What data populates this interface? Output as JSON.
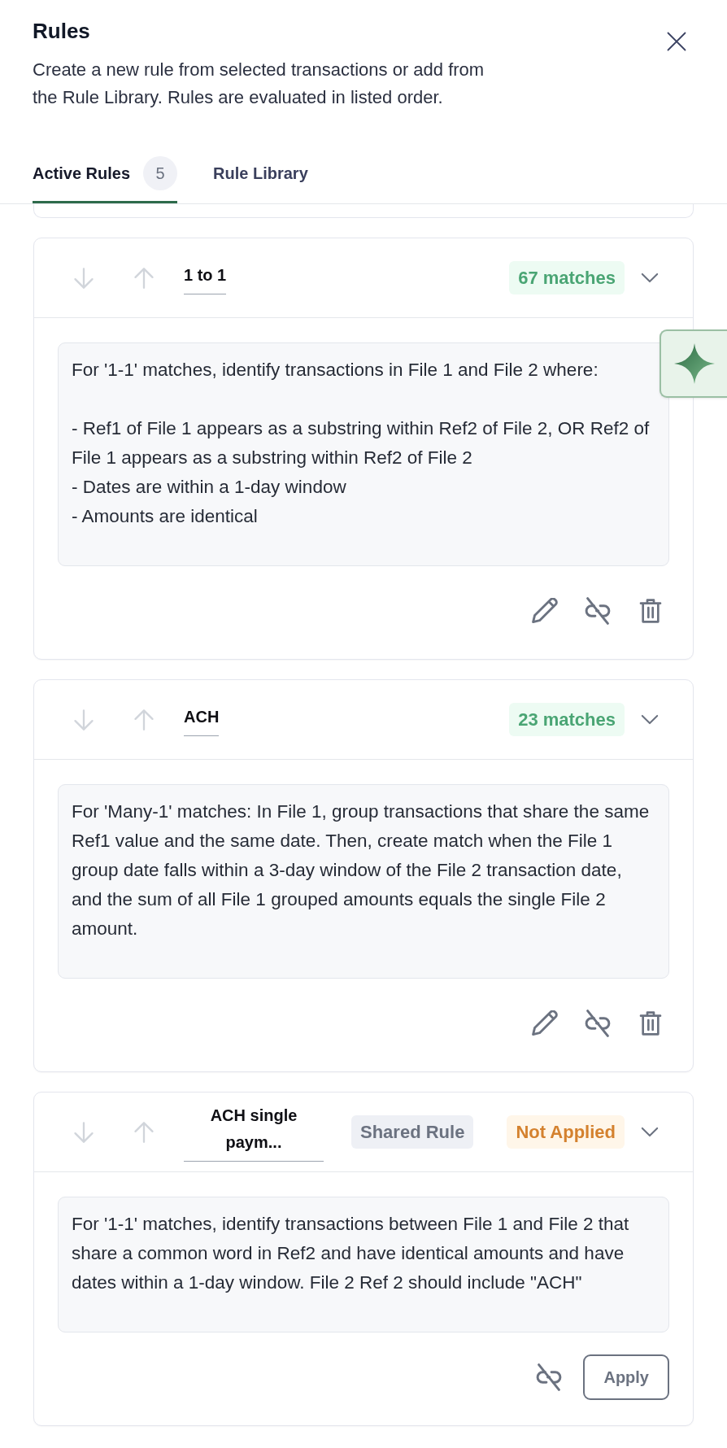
{
  "panel": {
    "title": "Rules",
    "description": "Create a new rule from selected transactions or add from the Rule Library. Rules are evaluated in listed order."
  },
  "tabs": [
    {
      "label": "Active Rules",
      "count": "5",
      "selected": true
    },
    {
      "label": "Rule Library",
      "selected": false
    }
  ],
  "rules": [
    {
      "name": "1 to 1",
      "status": {
        "text": "67 matches",
        "kind": "matched"
      },
      "expanded": true,
      "description": "For '1-1' matches, identify transactions in File 1 and File 2 where:\n\n- Ref1 of File 1 appears as a substring within Ref2 of File 2, OR Ref2 of File 1 appears as a substring within Ref2 of File 2\n- Dates are within a 1-day window\n- Amounts are identical",
      "actions": [
        {
          "kind": "edit"
        },
        {
          "kind": "unlink"
        },
        {
          "kind": "delete"
        }
      ]
    },
    {
      "name": "ACH",
      "status": {
        "text": "23 matches",
        "kind": "matched"
      },
      "expanded": true,
      "description": "For 'Many-1' matches: In File 1, group transactions that share the same Ref1 value and the same date. Then, create match when the File 1 group date falls within a 3-day window of the File 2 transaction date, and the sum of all File 1 grouped amounts equals the single File 2 amount.",
      "actions": [
        {
          "kind": "edit"
        },
        {
          "kind": "unlink"
        },
        {
          "kind": "delete"
        }
      ]
    },
    {
      "name": "ACH single paym...",
      "tag": "Shared Rule",
      "status": {
        "text": "Not Applied",
        "kind": "not_applied"
      },
      "expanded": true,
      "description": "For '1-1' matches, identify transactions between File 1 and File 2 that share a common word in Ref2 and have identical amounts and have dates within a 1-day window. File 2 Ref 2 should include \"ACH\"",
      "actions": [
        {
          "kind": "unlink"
        },
        {
          "kind": "button",
          "label": "Apply"
        }
      ]
    }
  ]
}
